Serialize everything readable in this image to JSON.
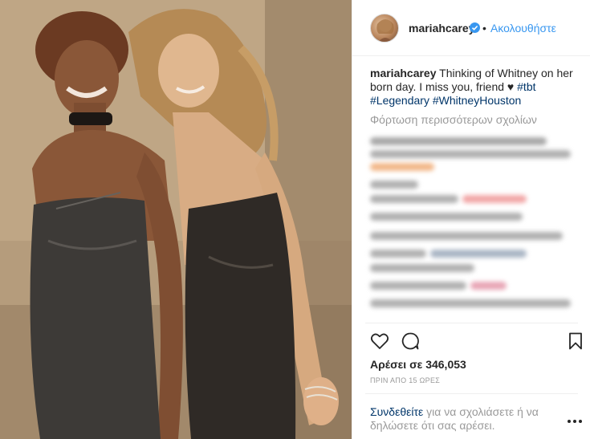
{
  "post": {
    "username": "mariahcarey",
    "follow_label": "Ακολουθήστε",
    "separator": "•",
    "caption_user": "mariahcarey",
    "caption_text": " Thinking of Whitney on her born day. I miss you, friend ♥ ",
    "hashtags": [
      "#tbt",
      "#Legendary",
      "#WhitneyHouston"
    ],
    "load_more": "Φόρτωση περισσότερων σχολίων",
    "likes": "Αρέσει σε 346,053",
    "time_ago": "ΠΡΙΝ ΑΠΟ 15 ΩΡΕΣ",
    "login_link": "Συνδεθείτε",
    "login_text": " για να σχολιάσετε ή να δηλώσετε ότι σας αρέσει."
  },
  "icons": {
    "verified": "verified-badge-icon",
    "like": "heart-icon",
    "comment": "comment-bubble-icon",
    "save": "bookmark-icon",
    "more": "more-options-icon"
  },
  "colors": {
    "link_blue": "#3897f0",
    "hashtag": "#003569",
    "muted": "#999999",
    "text": "#262626"
  }
}
